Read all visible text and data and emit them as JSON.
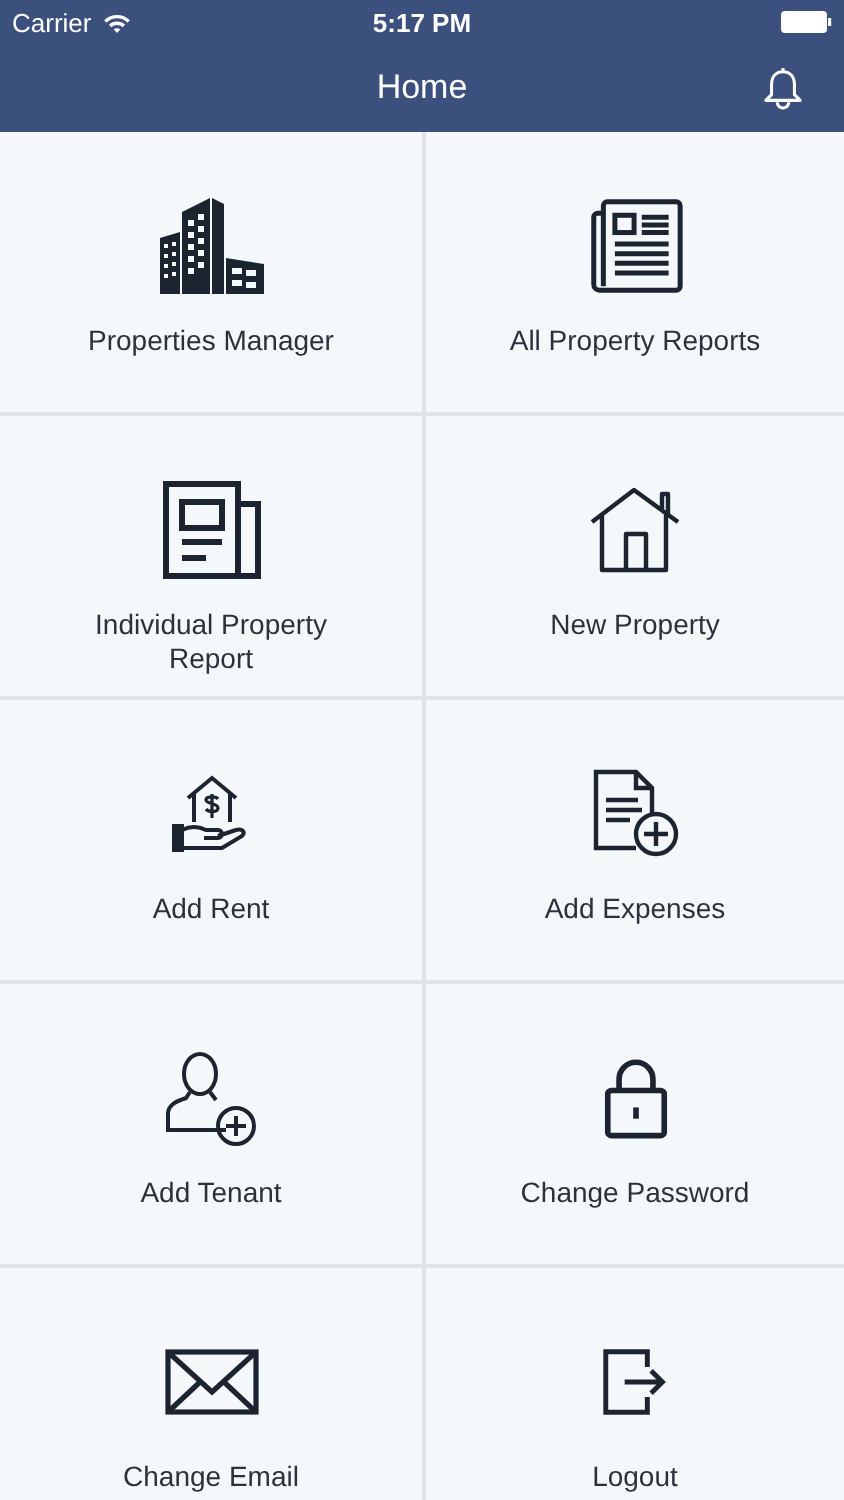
{
  "status_bar": {
    "carrier": "Carrier",
    "time": "5:17 PM"
  },
  "nav_bar": {
    "title": "Home"
  },
  "tiles": [
    {
      "label": "Properties Manager",
      "kind": "buildings"
    },
    {
      "label": "All Property Reports",
      "kind": "newspaper"
    },
    {
      "label": "Individual Property Report",
      "kind": "report"
    },
    {
      "label": "New Property",
      "kind": "house"
    },
    {
      "label": "Add Rent",
      "kind": "rent"
    },
    {
      "label": "Add Expenses",
      "kind": "expense"
    },
    {
      "label": "Add Tenant",
      "kind": "tenant"
    },
    {
      "label": "Change Password",
      "kind": "lock"
    },
    {
      "label": "Change Email",
      "kind": "mail"
    },
    {
      "label": "Logout",
      "kind": "logout"
    }
  ]
}
